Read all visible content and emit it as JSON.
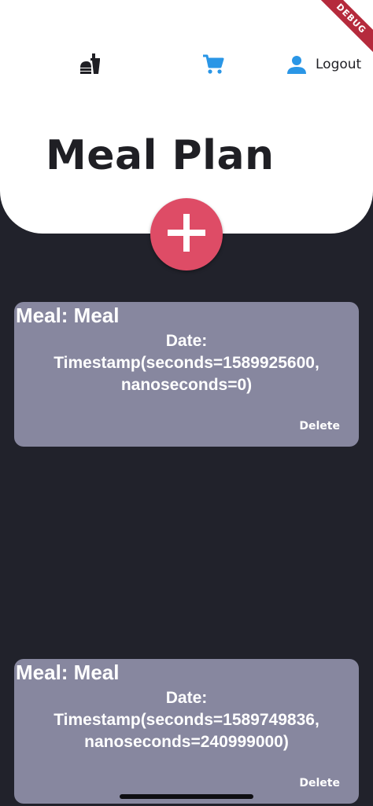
{
  "nav": {
    "meal_icon": "dinner-dining-icon",
    "cart_icon": "shopping-cart-icon",
    "user_icon": "person-icon",
    "logout_label": "Logout"
  },
  "header": {
    "title": "Meal Plan"
  },
  "debug_banner": "DEBUG",
  "fab": {
    "icon": "plus-icon"
  },
  "colors": {
    "background": "#21222b",
    "header": "#ffffff",
    "accent_fab": "#de4c66",
    "card": "#87879f",
    "cart_icon": "#2a96e6",
    "user_icon": "#2a96e6"
  },
  "cards": [
    {
      "meal": "Meal: Meal",
      "date_label": "Date:",
      "date_line1": "Timestamp(seconds=1589925600,",
      "date_line2": "nanoseconds=0)",
      "delete_label": "Delete"
    },
    {
      "meal": "Meal: Meal",
      "date_label": "Date:",
      "date_line1": "Timestamp(seconds=1589749836,",
      "date_line2": "nanoseconds=240999000)",
      "delete_label": "Delete"
    }
  ]
}
